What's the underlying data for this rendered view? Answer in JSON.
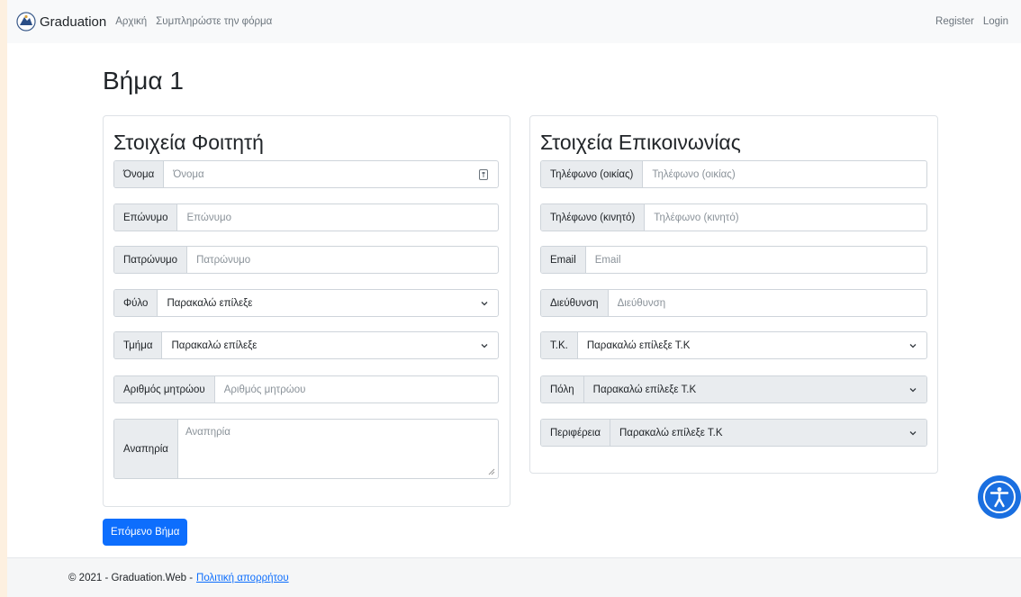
{
  "navbar": {
    "brand": "Graduation",
    "links": [
      "Αρχική",
      "Συμπληρώστε την φόρμα"
    ],
    "register": "Register",
    "login": "Login"
  },
  "page_title": "Βήμα 1",
  "student": {
    "title": "Στοιχεία Φοιτητή",
    "fields": {
      "name": {
        "label": "Όνομα",
        "placeholder": "Όνομα"
      },
      "surname": {
        "label": "Επώνυμο",
        "placeholder": "Επώνυμο"
      },
      "father": {
        "label": "Πατρώνυμο",
        "placeholder": "Πατρώνυμο"
      },
      "gender": {
        "label": "Φύλο",
        "value": "Παρακαλώ επίλεξε"
      },
      "department": {
        "label": "Τμήμα",
        "value": "Παρακαλώ επίλεξε"
      },
      "registry": {
        "label": "Αριθμός μητρώου",
        "placeholder": "Αριθμός μητρώου"
      },
      "disability": {
        "label": "Αναπηρία",
        "placeholder": "Αναπηρία"
      }
    }
  },
  "contact": {
    "title": "Στοιχεία Επικοινωνίας",
    "fields": {
      "home_phone": {
        "label": "Τηλέφωνο (οικίας)",
        "placeholder": "Τηλέφωνο (οικίας)"
      },
      "mobile_phone": {
        "label": "Τηλέφωνο (κινητό)",
        "placeholder": "Τηλέφωνο (κινητό)"
      },
      "email": {
        "label": "Email",
        "placeholder": "Email"
      },
      "address": {
        "label": "Διεύθυνση",
        "placeholder": "Διεύθυνση"
      },
      "postal_code": {
        "label": "Τ.Κ.",
        "value": "Παρακαλώ επίλεξε Τ.Κ"
      },
      "city": {
        "label": "Πόλη",
        "value": "Παρακαλώ επίλεξε Τ.Κ"
      },
      "region": {
        "label": "Περιφέρεια",
        "value": "Παρακαλώ επίλεξε Τ.Κ"
      }
    }
  },
  "next_button": "Επόμενο Βήμα",
  "footer": {
    "text": "© 2021 - Graduation.Web -",
    "privacy_link": "Πολιτική απορρήτου"
  },
  "colors": {
    "primary": "#0d6efd",
    "outer_background": "#fdf0e0",
    "accessibility": "#1a6fe0"
  }
}
